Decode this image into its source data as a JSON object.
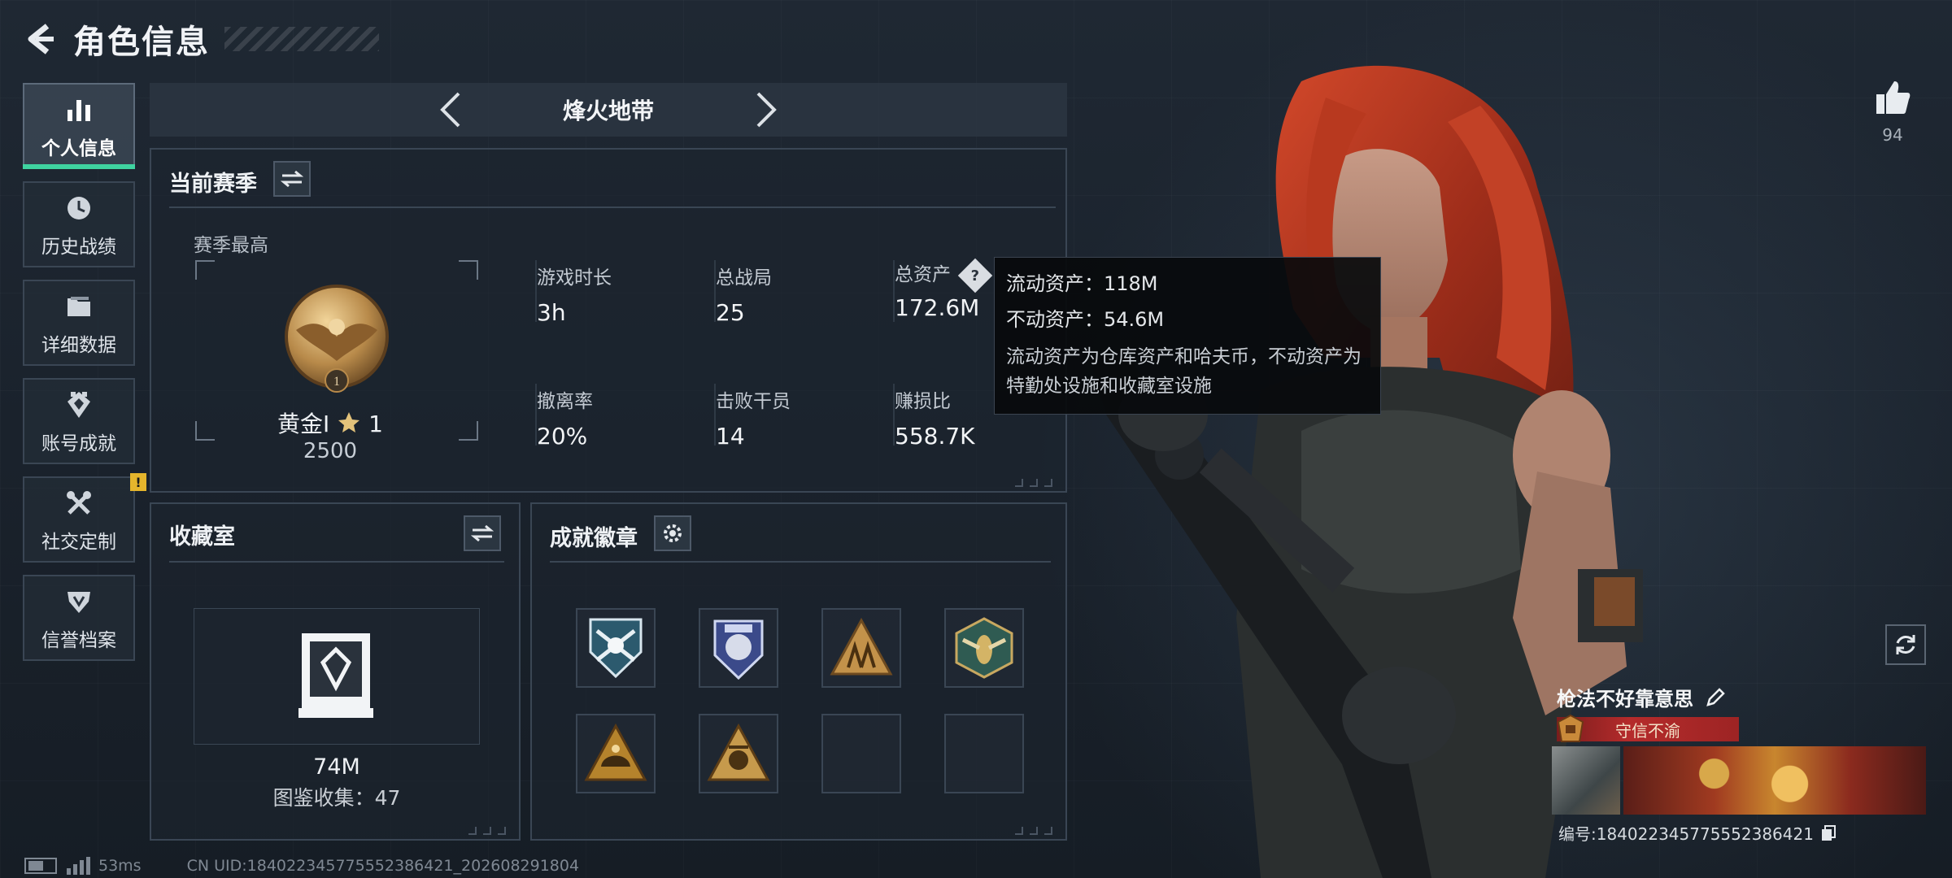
{
  "header": {
    "title": "角色信息"
  },
  "sidebar": {
    "items": [
      {
        "label": "个人信息",
        "icon": "bar-chart-icon",
        "active": true
      },
      {
        "label": "历史战绩",
        "icon": "clock-icon"
      },
      {
        "label": "详细数据",
        "icon": "folder-icon"
      },
      {
        "label": "账号成就",
        "icon": "achievement-icon"
      },
      {
        "label": "社交定制",
        "icon": "wrench-icon",
        "alert": "!"
      },
      {
        "label": "信誉档案",
        "icon": "shield-icon"
      }
    ]
  },
  "mode_selector": {
    "label": "烽火地带"
  },
  "season": {
    "title": "当前赛季",
    "subtitle": "赛季最高",
    "rank_name": "黄金I",
    "rank_stars": "1",
    "rank_level_marker": "1",
    "rank_points": "2500",
    "stats": [
      {
        "label": "游戏时长",
        "value": "3h"
      },
      {
        "label": "总战局",
        "value": "25"
      },
      {
        "label": "总资产",
        "value": "172.6M",
        "help": "?"
      },
      {
        "label": "撤离率",
        "value": "20%"
      },
      {
        "label": "击败干员",
        "value": "14"
      },
      {
        "label": "赚损比",
        "value": "558.7K"
      }
    ]
  },
  "tooltip": {
    "line1": "流动资产：118M",
    "line2": "不动资产：54.6M",
    "desc": "流动资产为仓库资产和哈夫币，不动资产为特勤处设施和收藏室设施"
  },
  "collection": {
    "title": "收藏室",
    "value": "74M",
    "count_text": "图鉴收集：47"
  },
  "badges": {
    "title": "成就徽章",
    "slots": [
      {
        "icon": "crossed-guns-shield-icon",
        "filled": true
      },
      {
        "icon": "police-badge-icon",
        "filled": true
      },
      {
        "icon": "soldiers-triangle-icon",
        "filled": true
      },
      {
        "icon": "wasp-hexagon-icon",
        "filled": true
      },
      {
        "icon": "helmet-triangle-icon",
        "filled": true
      },
      {
        "icon": "emblem-triangle-icon",
        "filled": true
      },
      {
        "icon": "empty-slot",
        "filled": false
      },
      {
        "icon": "empty-slot",
        "filled": false
      }
    ]
  },
  "profile": {
    "likes": "94",
    "player_name": "枪法不好靠意思",
    "title_badge": "守信不渝",
    "player_id": "编号:18402234577555238642​1"
  },
  "status_bar": {
    "ping": "53ms",
    "uid": "CN UID:18402234577555238642​1_202608291804"
  },
  "colors": {
    "accent_green": "#3fd3a0",
    "warning_yellow": "#e5b52c",
    "title_red": "#b52b2b",
    "hair_red": "#b53a22"
  }
}
